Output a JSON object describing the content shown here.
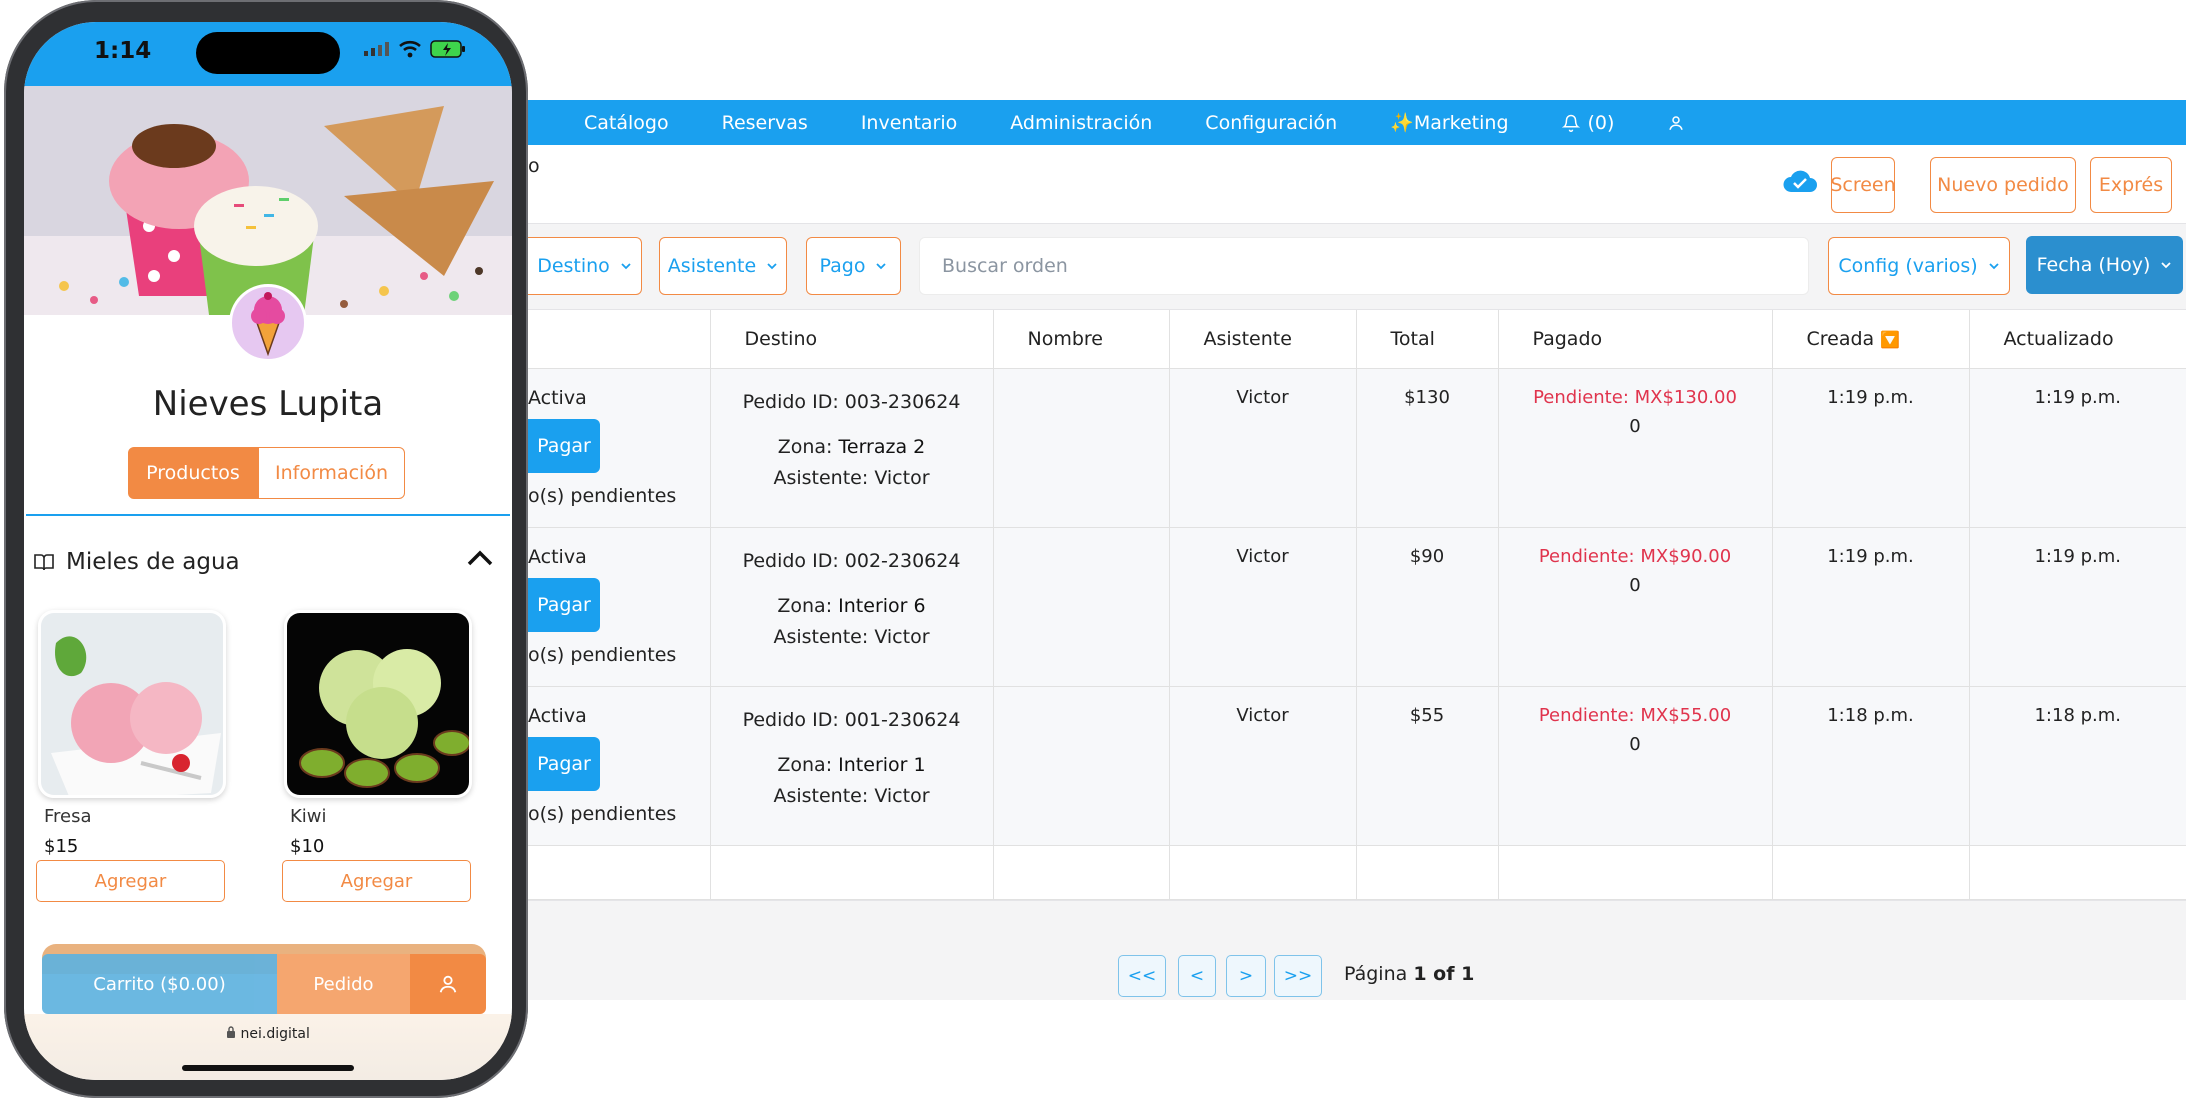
{
  "desktop": {
    "nav": {
      "items": [
        "Catálogo",
        "Reservas",
        "Inventario",
        "Administración",
        "Configuración",
        "✨Marketing"
      ],
      "notifications_label": "(0)"
    },
    "crumb_fragment": "o",
    "actions": {
      "screen": "Screen",
      "new_order": "Nuevo pedido",
      "express": "Exprés"
    },
    "filters": {
      "destination": "Destino",
      "assistant": "Asistente",
      "payment": "Pago",
      "config": "Config (varios)",
      "date": "Fecha (Hoy)"
    },
    "search": {
      "placeholder": "Buscar orden",
      "value": ""
    },
    "table": {
      "headers": {
        "destination": "Destino",
        "name": "Nombre",
        "assistant": "Asistente",
        "total": "Total",
        "paid": "Pagado",
        "created": "Creada",
        "created_sort_icon": "🔽",
        "updated": "Actualizado"
      },
      "rows": [
        {
          "status": "Activa",
          "pay_label": "Pagar",
          "pending_text": "o(s) pendientes",
          "order_id": "Pedido ID: 003-230624",
          "zone_label": "Zona:",
          "zone_value": "Terraza 2",
          "assistant_label": "Asistente:",
          "assistant_value": "Victor",
          "name": "",
          "assistant": "Victor",
          "total": "$130",
          "paid_pending": "Pendiente: MX$130.00",
          "paid_amount": "0",
          "created": "1:19 p.m.",
          "updated": "1:19 p.m."
        },
        {
          "status": "Activa",
          "pay_label": "Pagar",
          "pending_text": "o(s) pendientes",
          "order_id": "Pedido ID: 002-230624",
          "zone_label": "Zona:",
          "zone_value": "Interior 6",
          "assistant_label": "Asistente:",
          "assistant_value": "Victor",
          "name": "",
          "assistant": "Victor",
          "total": "$90",
          "paid_pending": "Pendiente: MX$90.00",
          "paid_amount": "0",
          "created": "1:19 p.m.",
          "updated": "1:19 p.m."
        },
        {
          "status": "Activa",
          "pay_label": "Pagar",
          "pending_text": "o(s) pendientes",
          "order_id": "Pedido ID: 001-230624",
          "zone_label": "Zona:",
          "zone_value": "Interior 1",
          "assistant_label": "Asistente:",
          "assistant_value": "Victor",
          "name": "",
          "assistant": "Victor",
          "total": "$55",
          "paid_pending": "Pendiente: MX$55.00",
          "paid_amount": "0",
          "created": "1:18 p.m.",
          "updated": "1:18 p.m."
        }
      ]
    },
    "pager": {
      "first": "<<",
      "prev": "<",
      "next": ">",
      "last": ">>",
      "page_word": "Página",
      "page_value": "1 of 1"
    },
    "icons": {
      "bell": "bell-icon",
      "user": "user-icon",
      "cloud": "cloud-check-icon"
    },
    "colors": {
      "primary": "#1aa0ef",
      "accent": "#f28a44",
      "pending": "#e0344d",
      "date_button": "#2b8fcf"
    }
  },
  "phone": {
    "time": "1:14",
    "store_name": "Nieves Lupita",
    "tabs": {
      "products": "Productos",
      "info": "Información"
    },
    "section_title": "Mieles de agua",
    "products": [
      {
        "name": "Fresa",
        "price": "$15",
        "add_label": "Agregar"
      },
      {
        "name": "Kiwi",
        "price": "$10",
        "add_label": "Agregar"
      }
    ],
    "bottom": {
      "cart": "Carrito ($0.00)",
      "order": "Pedido"
    },
    "url": "nei.digital"
  }
}
